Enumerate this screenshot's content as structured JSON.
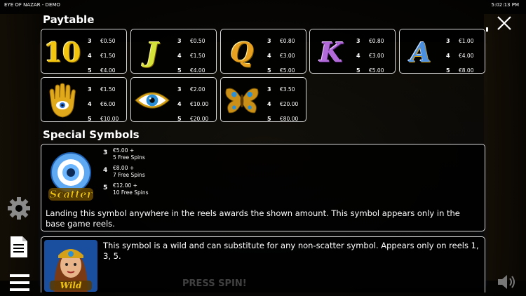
{
  "window": {
    "title": "EYE OF NAZAR - DEMO",
    "clock": "5:02:13 PM"
  },
  "paytable": {
    "heading": "Paytable",
    "symbols": [
      {
        "icon": "ten-symbol",
        "label": "10",
        "pays": [
          {
            "n": "3",
            "v": "€0.50"
          },
          {
            "n": "4",
            "v": "€1.50"
          },
          {
            "n": "5",
            "v": "€4.00"
          }
        ]
      },
      {
        "icon": "j-symbol",
        "label": "J",
        "pays": [
          {
            "n": "3",
            "v": "€0.50"
          },
          {
            "n": "4",
            "v": "€1.50"
          },
          {
            "n": "5",
            "v": "€4.00"
          }
        ]
      },
      {
        "icon": "q-symbol",
        "label": "Q",
        "pays": [
          {
            "n": "3",
            "v": "€0.80"
          },
          {
            "n": "4",
            "v": "€3.00"
          },
          {
            "n": "5",
            "v": "€5.00"
          }
        ]
      },
      {
        "icon": "k-symbol",
        "label": "K",
        "pays": [
          {
            "n": "3",
            "v": "€0.80"
          },
          {
            "n": "4",
            "v": "€3.00"
          },
          {
            "n": "5",
            "v": "€5.00"
          }
        ]
      },
      {
        "icon": "a-symbol",
        "label": "A",
        "pays": [
          {
            "n": "3",
            "v": "€1.00"
          },
          {
            "n": "4",
            "v": "€4.00"
          },
          {
            "n": "5",
            "v": "€8.00"
          }
        ]
      },
      {
        "icon": "hamsa-symbol",
        "pays": [
          {
            "n": "3",
            "v": "€1.50"
          },
          {
            "n": "4",
            "v": "€6.00"
          },
          {
            "n": "5",
            "v": "€10.00"
          }
        ]
      },
      {
        "icon": "eye-symbol",
        "pays": [
          {
            "n": "3",
            "v": "€2.00"
          },
          {
            "n": "4",
            "v": "€10.00"
          },
          {
            "n": "5",
            "v": "€20.00"
          }
        ]
      },
      {
        "icon": "butterfly-symbol",
        "pays": [
          {
            "n": "3",
            "v": "€3.50"
          },
          {
            "n": "4",
            "v": "€20.00"
          },
          {
            "n": "5",
            "v": "€80.00"
          }
        ]
      }
    ]
  },
  "special": {
    "heading": "Special Symbols",
    "scatter": {
      "icon": "scatter-nazar-symbol",
      "logo_text": "Scatter",
      "pays": [
        {
          "n": "3",
          "amount": "€5.00 +",
          "spins": "5 Free Spins"
        },
        {
          "n": "4",
          "amount": "€8.00 +",
          "spins": "7 Free Spins"
        },
        {
          "n": "5",
          "amount": "€12.00 +",
          "spins": "10 Free Spins"
        }
      ],
      "description": "Landing this symbol anywhere in the reels awards the shown amount. This symbol appears only in the base game reels."
    },
    "wild": {
      "icon": "wild-princess-symbol",
      "logo_text": "Wild",
      "description": "This symbol is a wild and can substitute for any non-scatter symbol. Appears only on reels 1, 3, 5."
    }
  },
  "background": {
    "press_spin": "PRESS SPIN!"
  },
  "colors": {
    "gold": "#f1c40f",
    "card_border": "#d9d9d9",
    "purple": "#8e44ad",
    "blue": "#3b7ddd"
  }
}
